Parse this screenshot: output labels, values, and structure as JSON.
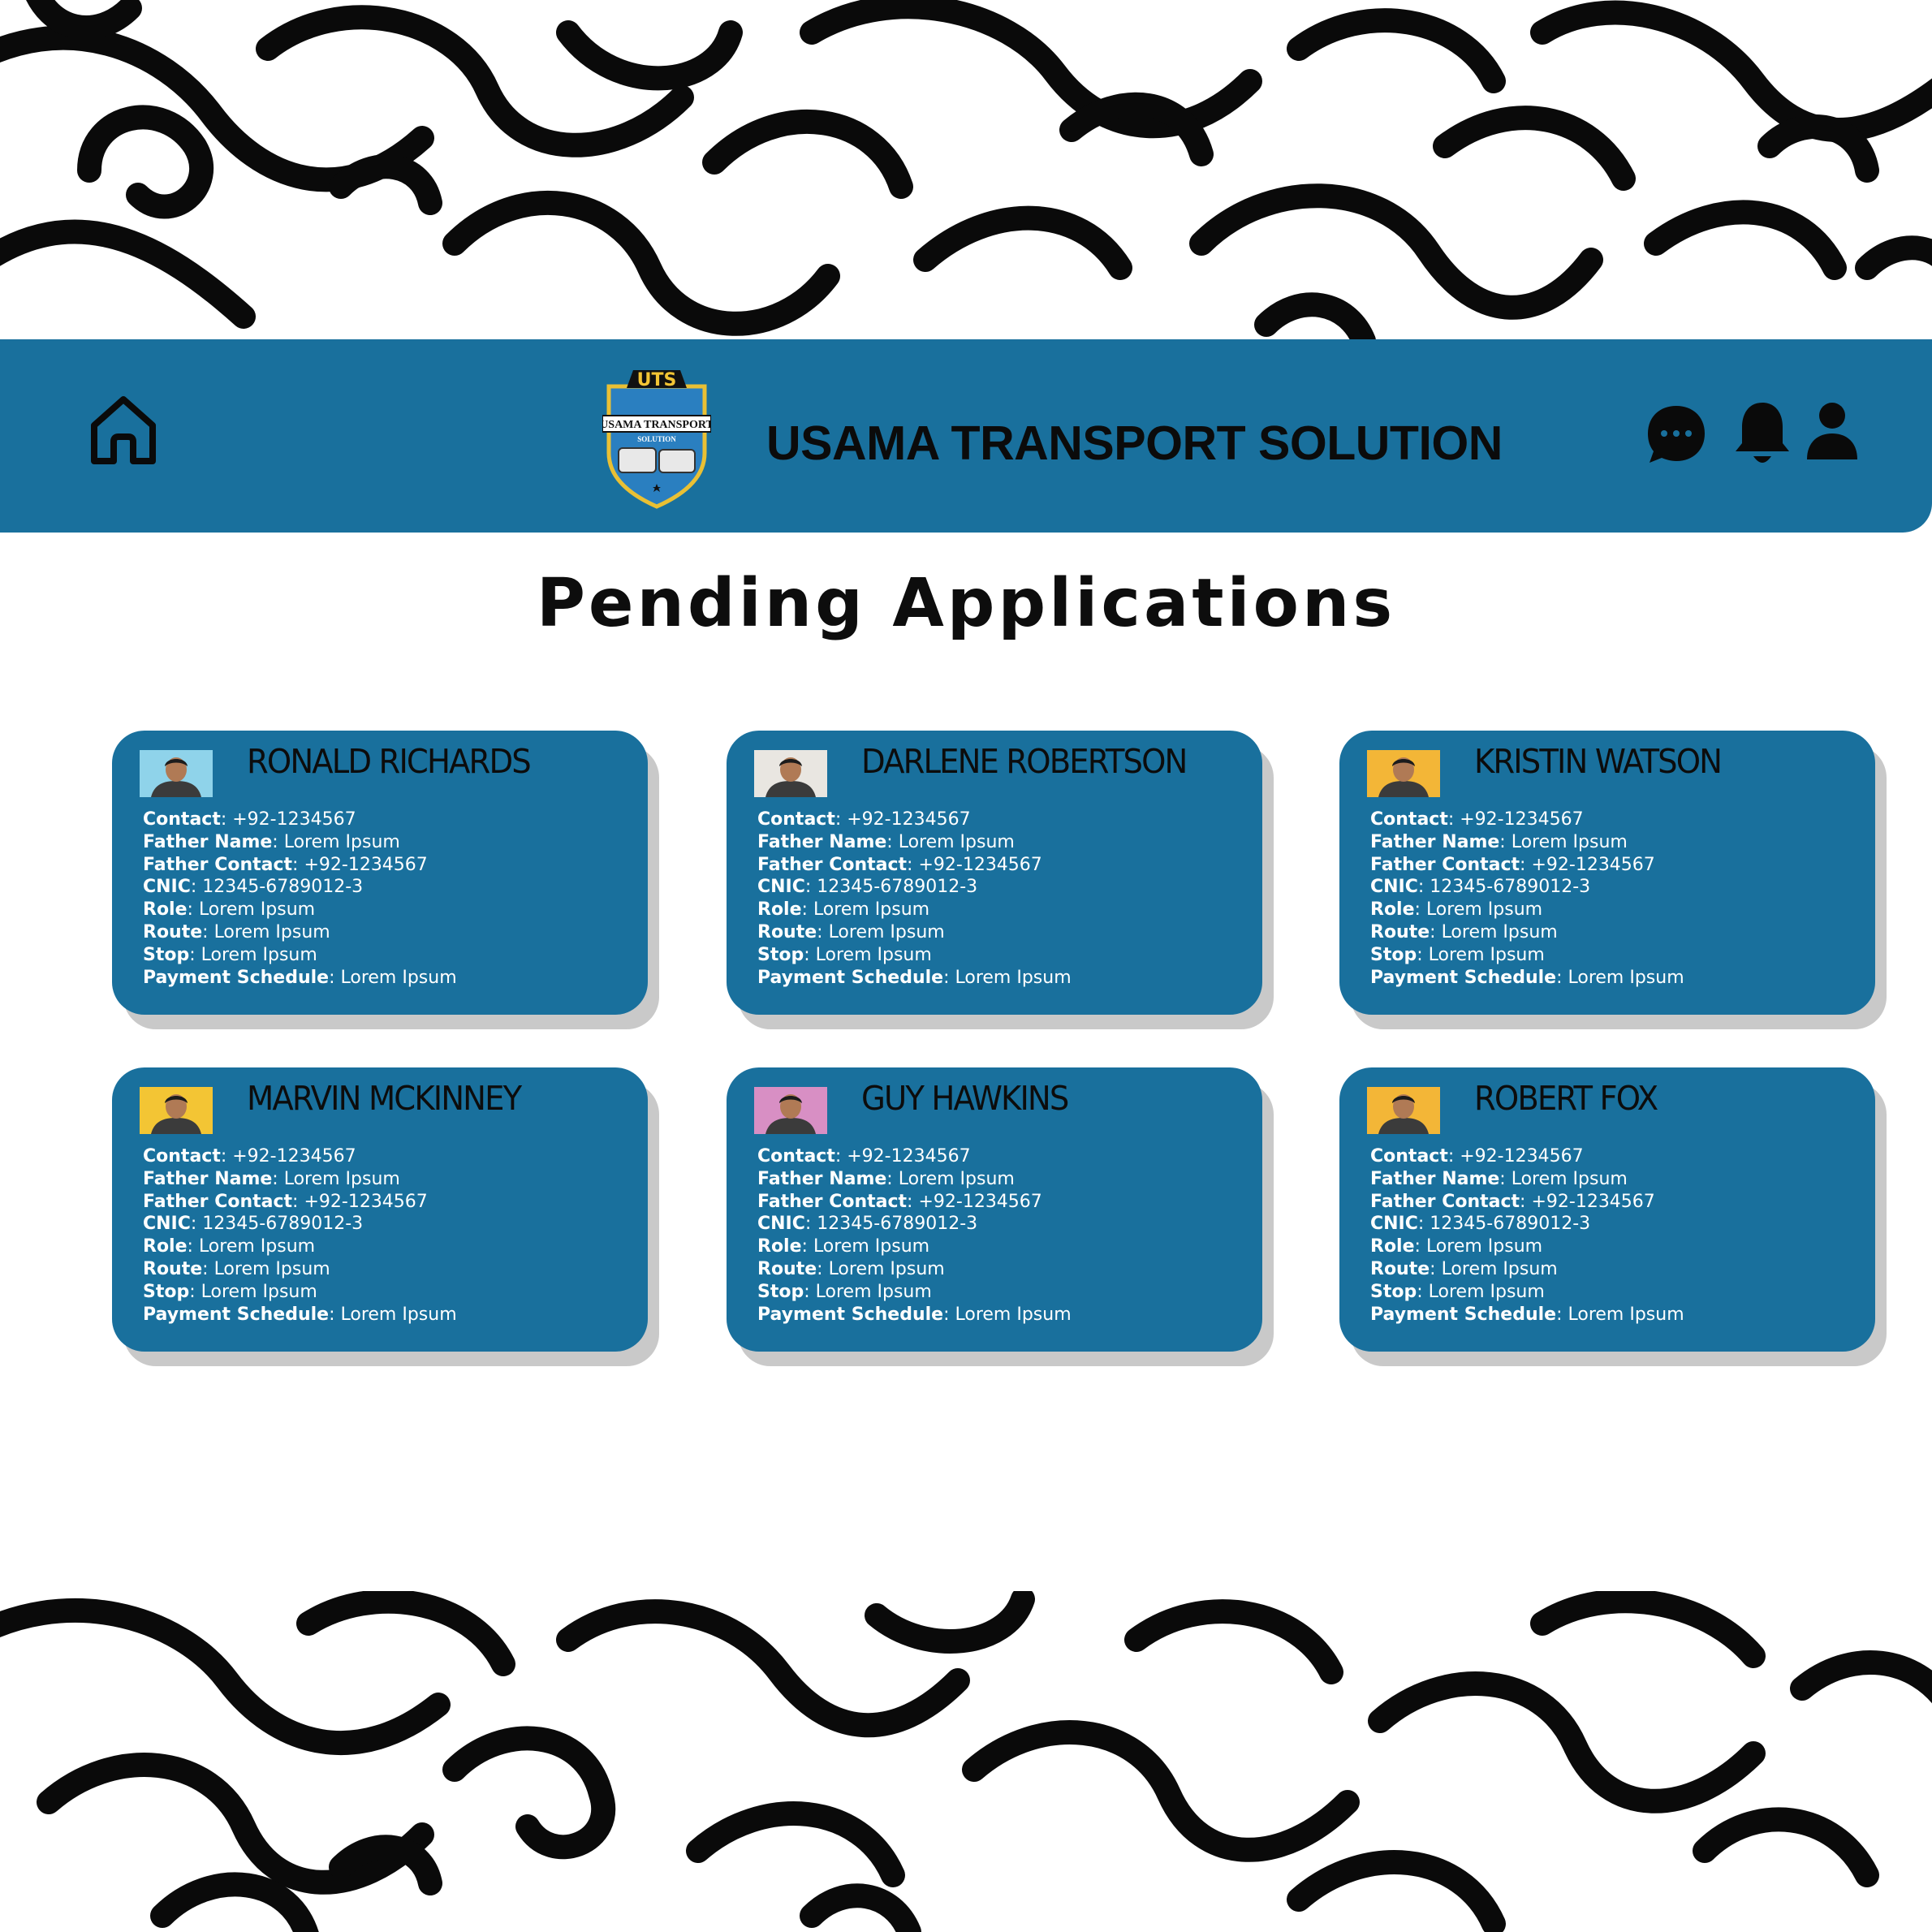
{
  "header": {
    "brand_name": "USAMA TRANSPORT SOLUTION",
    "logo": {
      "monogram": "UTS",
      "line1": "USAMA TRANSPORT",
      "line2": "SOLUTION"
    },
    "icons": {
      "home": "home-icon",
      "chat": "chat-bubble-icon",
      "notifications": "bell-icon",
      "profile": "user-icon"
    },
    "color": "#19709d"
  },
  "page": {
    "title": "Pending Applications"
  },
  "field_labels": {
    "contact": "Contact",
    "father_name": "Father Name",
    "father_contact": "Father Contact",
    "cnic": "CNIC",
    "role": "Role",
    "route": "Route",
    "stop": "Stop",
    "payment_schedule": "Payment Schedule"
  },
  "applications": [
    {
      "name": "RONALD RICHARDS",
      "contact": "+92-1234567",
      "father_name": "Lorem Ipsum",
      "father_contact": "+92-1234567",
      "cnic": "12345-6789012-3",
      "role": "Lorem Ipsum",
      "route": "Lorem Ipsum",
      "stop": "Lorem Ipsum",
      "payment_schedule": "Lorem Ipsum",
      "photo_bg": "#8fd3ea"
    },
    {
      "name": "DARLENE ROBERTSON",
      "contact": "+92-1234567",
      "father_name": "Lorem Ipsum",
      "father_contact": "+92-1234567",
      "cnic": "12345-6789012-3",
      "role": "Lorem Ipsum",
      "route": "Lorem Ipsum",
      "stop": "Lorem Ipsum",
      "payment_schedule": "Lorem Ipsum",
      "photo_bg": "#e9e6e1"
    },
    {
      "name": "KRISTIN WATSON",
      "contact": "+92-1234567",
      "father_name": "Lorem Ipsum",
      "father_contact": "+92-1234567",
      "cnic": "12345-6789012-3",
      "role": "Lorem Ipsum",
      "route": "Lorem Ipsum",
      "stop": "Lorem Ipsum",
      "payment_schedule": "Lorem Ipsum",
      "photo_bg": "#f3b637"
    },
    {
      "name": "MARVIN MCKINNEY",
      "contact": "+92-1234567",
      "father_name": "Lorem Ipsum",
      "father_contact": "+92-1234567",
      "cnic": "12345-6789012-3",
      "role": "Lorem Ipsum",
      "route": "Lorem Ipsum",
      "stop": "Lorem Ipsum",
      "payment_schedule": "Lorem Ipsum",
      "photo_bg": "#f3c534"
    },
    {
      "name": "GUY HAWKINS",
      "contact": "+92-1234567",
      "father_name": "Lorem Ipsum",
      "father_contact": "+92-1234567",
      "cnic": "12345-6789012-3",
      "role": "Lorem Ipsum",
      "route": "Lorem Ipsum",
      "stop": "Lorem Ipsum",
      "payment_schedule": "Lorem Ipsum",
      "photo_bg": "#d88fc4"
    },
    {
      "name": "ROBERT FOX",
      "contact": "+92-1234567",
      "father_name": "Lorem Ipsum",
      "father_contact": "+92-1234567",
      "cnic": "12345-6789012-3",
      "role": "Lorem Ipsum",
      "route": "Lorem Ipsum",
      "stop": "Lorem Ipsum",
      "payment_schedule": "Lorem Ipsum",
      "photo_bg": "#f3b637"
    }
  ]
}
